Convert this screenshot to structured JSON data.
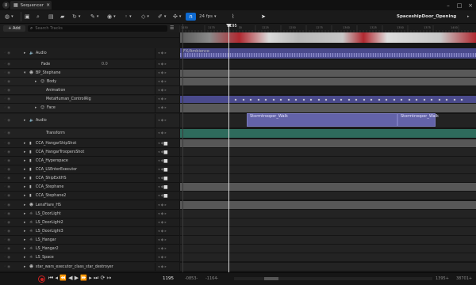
{
  "window": {
    "tab_title": "Sequencer",
    "sequence_name": "SpaceshipDoor_Opening"
  },
  "toolbar": {
    "fps": "24 fps"
  },
  "add_button": {
    "label": "+ Add"
  },
  "search": {
    "placeholder": "Search Tracks"
  },
  "ruler": {
    "current_frame": "1195",
    "ticks": [
      "1150",
      "1175",
      "1200",
      "1225",
      "1250",
      "1275",
      "1300",
      "1325",
      "1350",
      "1375",
      "1400"
    ]
  },
  "tracks": [
    {
      "label": "Audio",
      "kind": "audio"
    },
    {
      "label": "Fade",
      "value": "0.0",
      "kind": "fade"
    },
    {
      "label": "BP_Stephane",
      "kind": "actor"
    },
    {
      "label": "Body",
      "kind": "component"
    },
    {
      "label": "Animation",
      "kind": "sub"
    },
    {
      "label": "MetaHuman_ControlRig",
      "kind": "sub"
    },
    {
      "label": "Face",
      "kind": "component"
    },
    {
      "label": "Audio",
      "kind": "audio"
    },
    {
      "label": "Transform",
      "kind": "sub"
    },
    {
      "label": "CCA_HangarShipShot",
      "kind": "camera"
    },
    {
      "label": "CCA_HangarTroopersShot",
      "kind": "camera"
    },
    {
      "label": "CCA_Hyperspace",
      "kind": "camera"
    },
    {
      "label": "CCA_LSEnterExecutor",
      "kind": "camera"
    },
    {
      "label": "CCA_ShipExitHS",
      "kind": "camera"
    },
    {
      "label": "CCA_Stephane",
      "kind": "camera"
    },
    {
      "label": "CCA_Stephane2",
      "kind": "camera"
    },
    {
      "label": "LensFlare_HS",
      "kind": "actor"
    },
    {
      "label": "LS_DoorLight",
      "kind": "light"
    },
    {
      "label": "LS_DoorLight2",
      "kind": "light"
    },
    {
      "label": "LS_DoorLight3",
      "kind": "light"
    },
    {
      "label": "LS_Hangar",
      "kind": "light"
    },
    {
      "label": "LS_Hangar2",
      "kind": "light"
    },
    {
      "label": "LS_Space",
      "kind": "light"
    },
    {
      "label": "star_wars_executor_class_star_destroyer",
      "kind": "actor"
    }
  ],
  "clips": {
    "camera_cuts": "",
    "fx_ambience": "FX/Ambience",
    "walk1": "Stormtrooper_Walk",
    "walk2": "Stormtrooper_Walk"
  },
  "bottom": {
    "current_frame": "1195",
    "view_start": "-0853-",
    "play_start": "-1164-",
    "play_end": "1395+",
    "view_end": "38701+"
  },
  "colors": {
    "accent": "#0e6ad1",
    "audio_clip": "#4a4a8c",
    "anim_clip": "#6363a8",
    "transform": "#2e6b5c",
    "camera_cut": "#b02830"
  }
}
